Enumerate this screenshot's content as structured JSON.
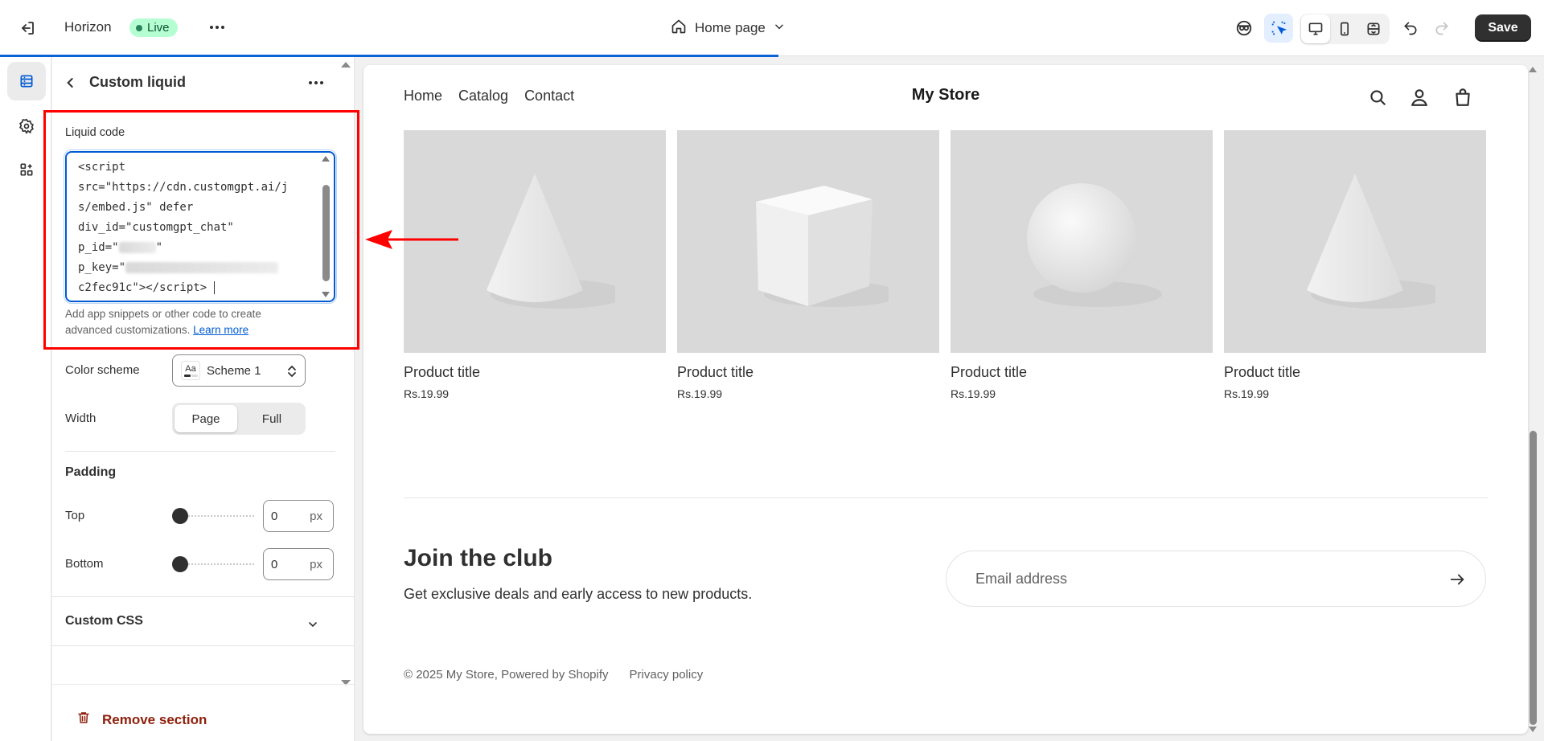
{
  "topbar": {
    "store_name": "Horizon",
    "status_badge": "Live",
    "page_selector": "Home page",
    "save_label": "Save",
    "progress": 0.504
  },
  "sidebar_rail": {
    "items": [
      {
        "icon": "sections-icon",
        "active": true
      },
      {
        "icon": "gear-icon",
        "active": false
      },
      {
        "icon": "apps-icon",
        "active": false
      }
    ]
  },
  "panel": {
    "title": "Custom liquid",
    "liquid_label": "Liquid code",
    "code_lines": [
      "<script",
      "src=\"https://cdn.customgpt.ai/j",
      "s/embed.js\" defer",
      "div_id=\"customgpt_chat\"",
      "p_id=\"",
      "p_key=\"",
      "c2fec91c\"></script> "
    ],
    "help_text": "Add app snippets or other code to create advanced customizations. ",
    "help_link": "Learn more",
    "color_scheme_label": "Color scheme",
    "color_scheme_value": "Scheme 1",
    "swatch_text": "Aa",
    "width_label": "Width",
    "width_options": [
      "Page",
      "Full"
    ],
    "width_selected": "Page",
    "padding_heading": "Padding",
    "padding_top_label": "Top",
    "padding_top_value": "0",
    "padding_bottom_label": "Bottom",
    "padding_bottom_value": "0",
    "unit": "px",
    "custom_css_heading": "Custom CSS",
    "remove_label": "Remove section"
  },
  "preview": {
    "nav": [
      "Home",
      "Catalog",
      "Contact"
    ],
    "brand": "My Store",
    "products": [
      {
        "title": "Product title",
        "price": "Rs.19.99",
        "shape": "cone"
      },
      {
        "title": "Product title",
        "price": "Rs.19.99",
        "shape": "cube"
      },
      {
        "title": "Product title",
        "price": "Rs.19.99",
        "shape": "sphere"
      },
      {
        "title": "Product title",
        "price": "Rs.19.99",
        "shape": "cone"
      }
    ],
    "club_heading": "Join the club",
    "club_sub": "Get exclusive deals and early access to new products.",
    "email_placeholder": "Email address",
    "footer_copyright": "© 2025 My Store, Powered by Shopify",
    "footer_privacy": "Privacy policy"
  },
  "colors": {
    "accent": "#005bd3",
    "save_bg": "#303030",
    "live_bg": "#b4fed2",
    "annotation_red": "#ff0000",
    "remove_red": "#8e1f0b"
  }
}
